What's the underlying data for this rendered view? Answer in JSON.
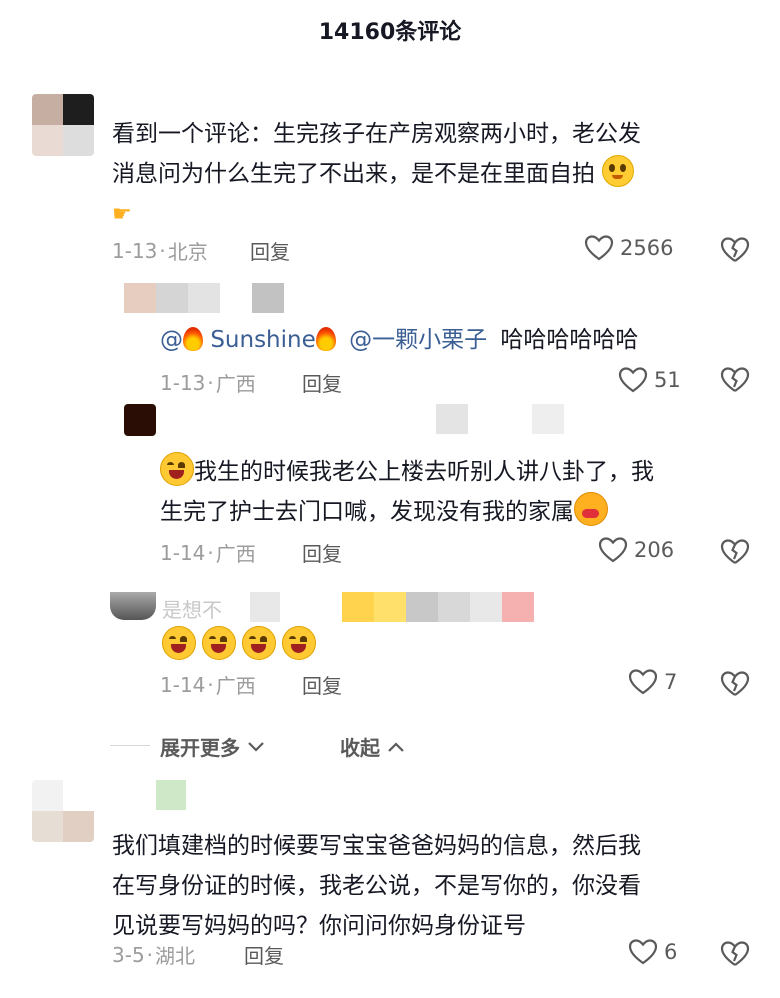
{
  "header": {
    "title": "14160条评论"
  },
  "comments": [
    {
      "text_line1": "看到一个评论：生完孩子在产房观察两小时，老公发",
      "text_line2": "消息问为什么生完了不出来，是不是在里面自拍",
      "date": "1-13",
      "location": "北京",
      "reply_label": "回复",
      "likes": "2566",
      "emojis": [
        "smile-emoji",
        "pointing-hand-emoji"
      ]
    },
    {
      "mention1": "@",
      "mention1_name": "Sunshine",
      "mention2": "@一颗小栗子",
      "text": "哈哈哈哈哈哈",
      "date": "1-13",
      "location": "广西",
      "reply_label": "回复",
      "likes": "51"
    },
    {
      "text_line1": "我生的时候我老公上楼去听别人讲八卦了，我",
      "text_line2": "生完了护士去门口喊，发现没有我的家属",
      "date": "1-14",
      "location": "广西",
      "reply_label": "回复",
      "likes": "206"
    },
    {
      "name_partial": "是想不",
      "date": "1-14",
      "location": "广西",
      "reply_label": "回复",
      "likes": "7",
      "emojis": [
        "laugh-cry-emoji",
        "laugh-cry-emoji",
        "laugh-cry-emoji",
        "laugh-cry-emoji"
      ]
    },
    {
      "text_line1": "我们填建档的时候要写宝宝爸爸妈妈的信息，然后我",
      "text_line2": "在写身份证的时候，我老公说，不是写你的，你没看",
      "text_line3": "见说要写妈妈的吗？你问问你妈身份证号",
      "date": "3-5",
      "location": "湖北",
      "reply_label": "回复",
      "likes": "6"
    }
  ],
  "replies_controls": {
    "expand_more": "展开更多",
    "collapse": "收起"
  },
  "meta_separator": "·"
}
